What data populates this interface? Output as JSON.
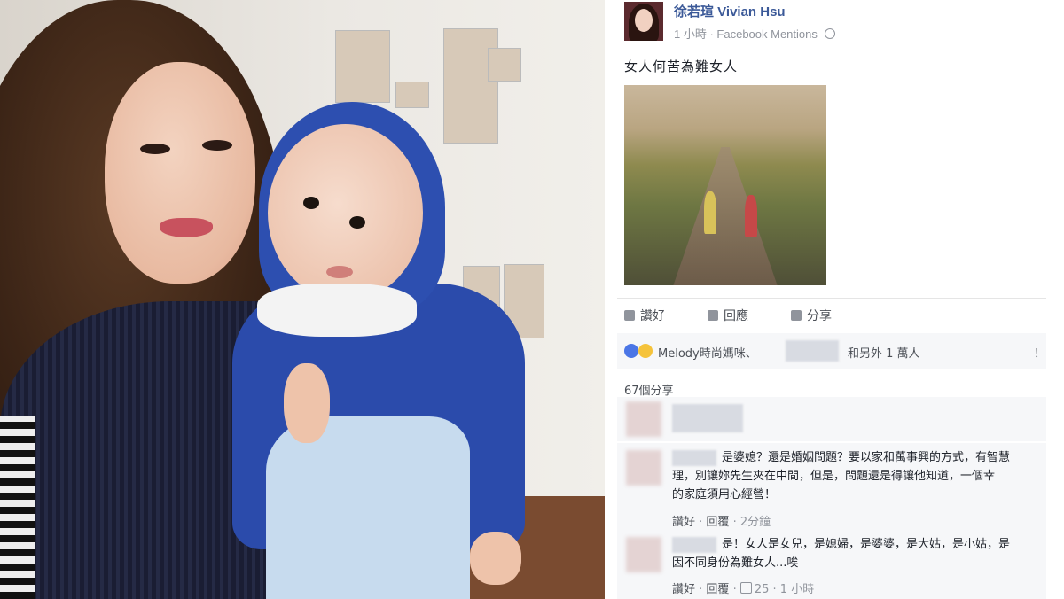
{
  "post": {
    "author": "徐若瑄 Vivian Hsu",
    "time": "1 小時",
    "source": "Facebook Mentions",
    "text": "女人何苦為難女人"
  },
  "actions": {
    "like": "讚好",
    "comment": "回應",
    "share": "分享"
  },
  "reactions": {
    "names": "Melody時尚媽咪、",
    "others": "和另外 1 萬人",
    "right_glyph": "！"
  },
  "shares_count": "67個分享",
  "comments": [
    {
      "lines": [
        "是婆媳？還是婚姻問題？要以家和萬事興的方式，有智慧",
        "理，別讓妳先生夾在中間，但是，問題還是得讓他知道，一個幸",
        "的家庭須用心經營！"
      ],
      "like": "讚好",
      "reply": "回覆",
      "time": "2分鐘"
    },
    {
      "lines": [
        "是！女人是女兒，是媳婦，是婆婆，是大姑，是小姑，是",
        "因不同身份為難女人...唉"
      ],
      "like": "讚好",
      "reply": "回覆",
      "likes": "25",
      "time": "1 小時"
    }
  ],
  "colors": {
    "link_blue": "#3b5998",
    "meta_gray": "#90949c",
    "hood_blue": "#2d4fb0"
  }
}
